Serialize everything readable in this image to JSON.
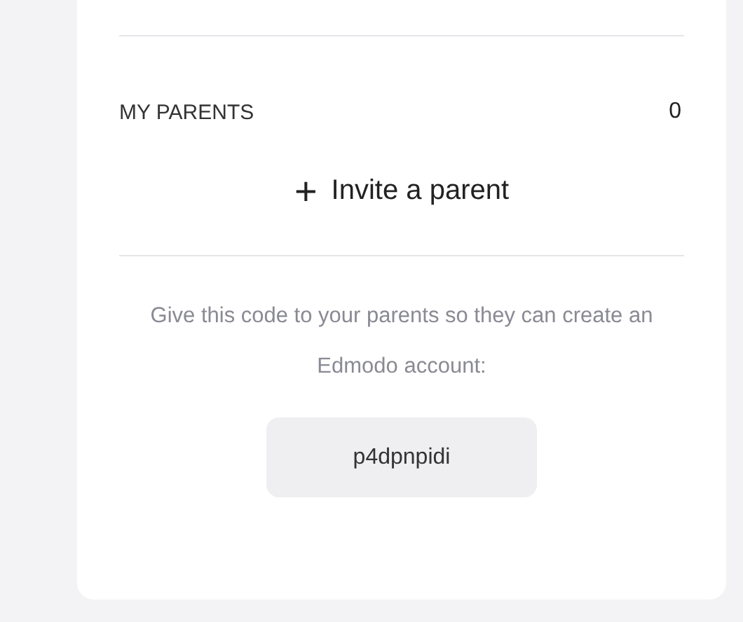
{
  "parents": {
    "heading": "MY PARENTS",
    "count": "0"
  },
  "invite": {
    "icon": "+",
    "label": "Invite a parent"
  },
  "code_hint": "Give this code to your parents so they can create an Edmodo account:",
  "code": "p4dpnpidi"
}
